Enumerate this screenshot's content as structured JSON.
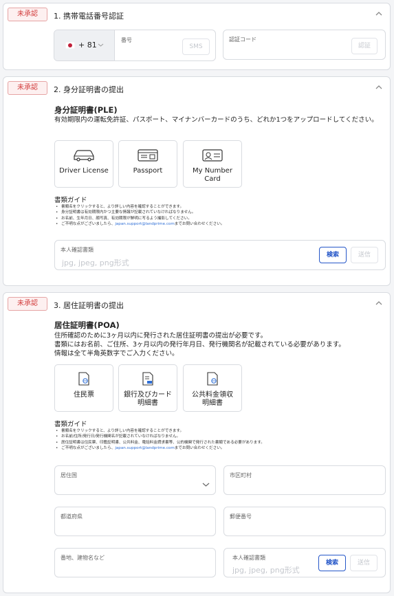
{
  "sections": [
    {
      "badge": "未承認",
      "title": "1. 携帯電話番号認証"
    },
    {
      "badge": "未承認",
      "title": "2. 身分証明書の提出"
    },
    {
      "badge": "未承認",
      "title": "3. 居住証明書の提出"
    }
  ],
  "phone": {
    "country_code": "+ 81",
    "number_label": "番号",
    "sms_button": "SMS",
    "code_label": "認証コード",
    "verify_button": "認証"
  },
  "ple": {
    "title": "身分証明書(PLE)",
    "description": "有効期限内の運転免許証、パスポート、マイナンバーカードのうち、どれか1つをアップロードしてください。",
    "cards": [
      "Driver License",
      "Passport",
      "My Number Card"
    ],
    "guide_title": "書類ガイド",
    "guide": [
      "書類名をクリックすると、より詳しい内容を確認することができます。",
      "身分証明書は有効期限内かつ主要な情報が記載されていなければなりません。",
      "お名前、生年月日、顔写真、有効期限が鮮明に写るよう撮影してください。"
    ],
    "guide_contact_pre": "ご不明な点がございましたら、",
    "guide_contact_email": "japan.support@landprime.com",
    "guide_contact_post": "までお問い合わせください。",
    "upload_label": "本人確認書類",
    "upload_placeholder": "jpg, jpeg, png形式",
    "search_button": "検索",
    "submit_button": "送信"
  },
  "poa": {
    "title": "居住証明書(POA)",
    "description": [
      "住所確認のために3ヶ月以内に発行された居住証明書の提出が必要です。",
      "書類にはお名前、ご住所、3ヶ月以内の発行年月日、発行機関名が記載されている必要があります。",
      "情報は全て半角英数字でご入力ください。"
    ],
    "cards": [
      "住民票",
      "銀行及びカード明細書",
      "公共料金領収明細書"
    ],
    "guide_title": "書類ガイド",
    "guide": [
      "書類名をクリックすると、より詳しい内容を確認することができます。",
      "お名前/住所/発行日/発行機関名が記載されていなければなりません。",
      "居住証明書は住民票、印鑑証明書、公共料金、電話料金請求書等、公的機関で発行された書類である必要があります。"
    ],
    "guide_contact_pre": "ご不明な点がございましたら、",
    "guide_contact_email": "japan.support@landprime.com",
    "guide_contact_post": "までお問い合わせください。",
    "fields": {
      "country": "居住国",
      "city": "市区町村",
      "prefecture": "都道府県",
      "postal": "郵便番号",
      "address": "番地、建物名など",
      "upload_label": "本人確認書類"
    },
    "upload_placeholder": "jpg, jpeg, png形式",
    "search_button": "検索",
    "submit_button": "送信"
  },
  "colors": {
    "badge_red": "#d23c3c",
    "primary_blue": "#2456c8",
    "link_blue": "#2f6fd6"
  },
  "icons": {
    "flag": "japan-flag-icon",
    "chevron": "chevron-up-icon",
    "driver": "car-icon",
    "passport": "passport-icon",
    "mynumber": "id-card-icon",
    "doc": "document-globe-icon"
  }
}
